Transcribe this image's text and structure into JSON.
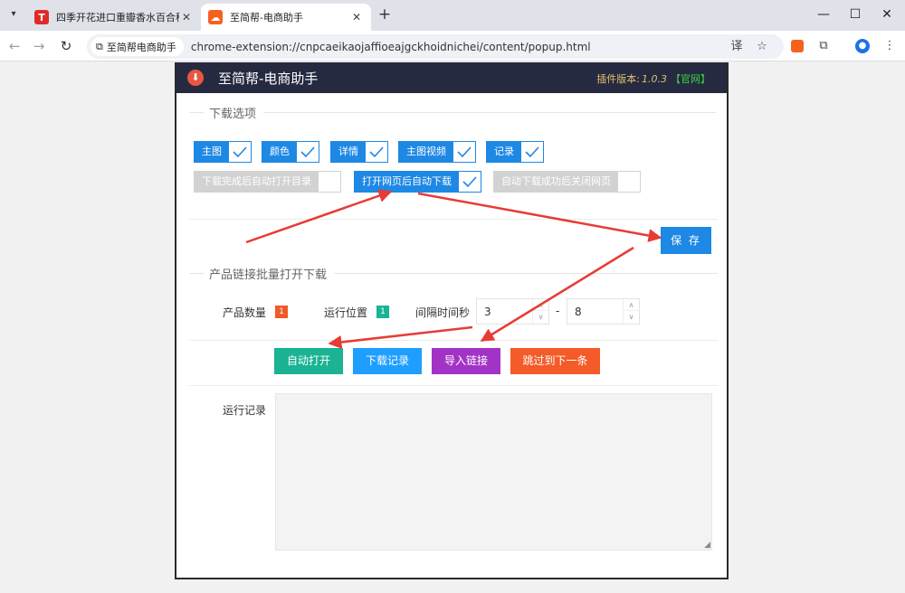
{
  "browser": {
    "tabs": [
      {
        "title": "四季开花进口重瓣香水百合种球",
        "favicon": "T",
        "favicon_color": "#e02a2a",
        "active": false
      },
      {
        "title": "至简帮-电商助手",
        "favicon": "☁",
        "favicon_color": "#f5621f",
        "active": true
      }
    ],
    "site_chip": "至简帮电商助手",
    "url": "chrome-extension://cnpcaeikaojaffioeajgckhoidnichei/content/popup.html"
  },
  "popup": {
    "title": "至简帮-电商助手",
    "version_label": "插件版本:",
    "version_number": "1.0.3",
    "official_link": "【官网】",
    "section1_title": "下载选项",
    "checkboxes_row1": [
      "主图",
      "颜色",
      "详情",
      "主图视频",
      "记录"
    ],
    "toggle_open_dir": "下载完成后自动打开目录",
    "toggle_auto_download": "打开网页后自动下载",
    "toggle_close_page": "自动下载成功后关闭网页",
    "save_label": "保 存",
    "section2_title": "产品链接批量打开下载",
    "product_count_label": "产品数量",
    "product_count": "1",
    "run_position_label": "运行位置",
    "run_position": "1",
    "interval_label": "间隔时间秒",
    "interval_min": "3",
    "interval_sep": "-",
    "interval_max": "8",
    "btn_auto_open": "自动打开",
    "btn_download_log": "下载记录",
    "btn_import_links": "导入链接",
    "btn_skip_next": "跳过到下一条",
    "run_log_label": "运行记录"
  },
  "colors": {
    "header_bg": "#252a41",
    "primary_blue": "#1e88e5",
    "teal": "#1ab394",
    "sky": "#1e9fff",
    "purple": "#a233c6",
    "orange": "#f45b28",
    "arrow_red": "#e83b35"
  }
}
